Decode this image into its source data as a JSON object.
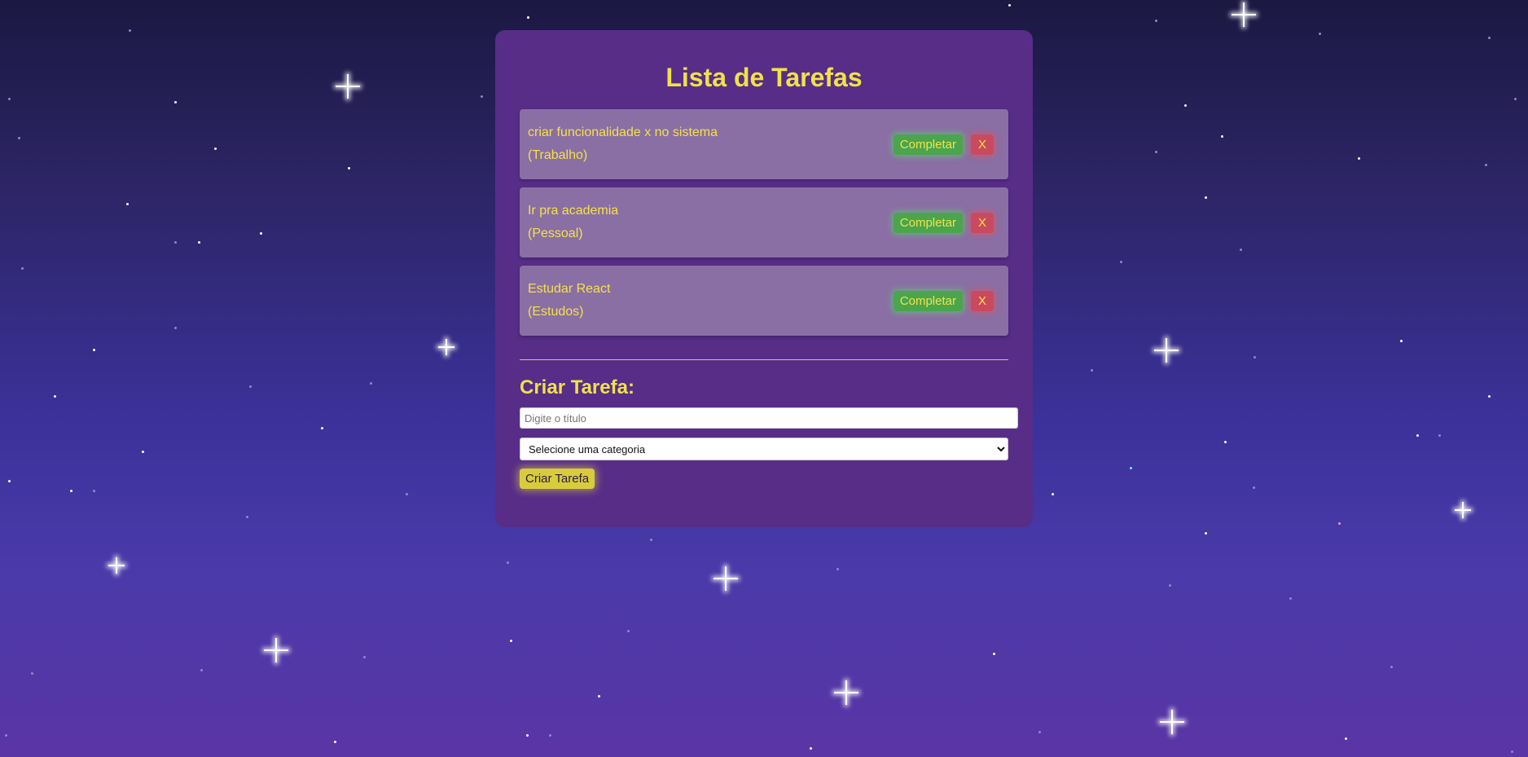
{
  "app": {
    "title": "Lista de Tarefas",
    "accent_color": "#f1e14a"
  },
  "tasks": [
    {
      "title": "criar funcionalidade x no sistema",
      "category": "(Trabalho)",
      "complete_label": "Completar",
      "delete_label": "X"
    },
    {
      "title": "Ir pra academia",
      "category": "(Pessoal)",
      "complete_label": "Completar",
      "delete_label": "X"
    },
    {
      "title": "Estudar React",
      "category": "(Estudos)",
      "complete_label": "Completar",
      "delete_label": "X"
    }
  ],
  "create_form": {
    "heading": "Criar Tarefa:",
    "title_input": {
      "placeholder": "Digite o título",
      "value": ""
    },
    "category_select": {
      "selected": "Selecione uma categoria"
    },
    "submit_label": "Criar Tarefa"
  },
  "colors": {
    "card_background": "#572d88",
    "task_background": "#8a6fa4",
    "complete_button": "#4aa54d",
    "delete_button": "#c94a5e",
    "create_button": "#d9cc3c"
  }
}
